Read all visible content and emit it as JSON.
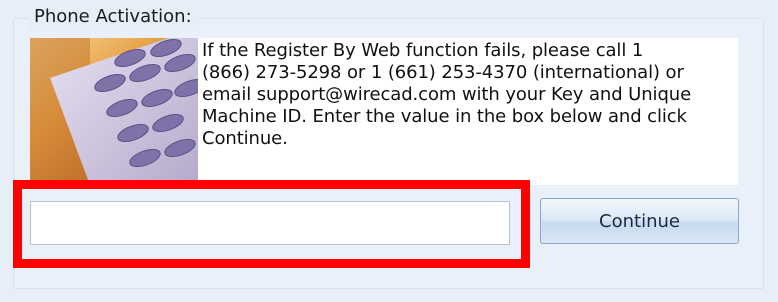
{
  "phone_activation": {
    "legend": "Phone Activation:",
    "instructions": "If the Register By Web function fails, please call 1\n(866) 273-5298 or 1 (661) 253-4370 (international) or\nemail support@wirecad.com with your Key and Unique\nMachine ID. Enter the value in the box below and click\nContinue.",
    "code_input_value": "",
    "continue_label": "Continue"
  },
  "colors": {
    "highlight": "#ff0000",
    "panel_background": "#e6eef8"
  }
}
